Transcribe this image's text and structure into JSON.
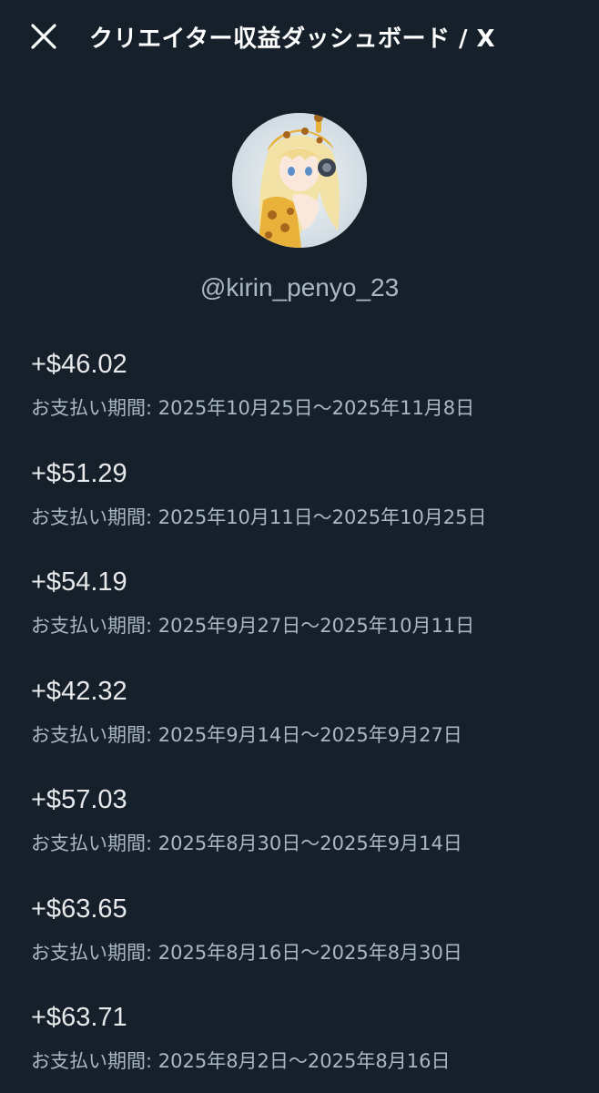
{
  "header": {
    "title": "クリエイター収益ダッシュボード / X"
  },
  "profile": {
    "handle": "@kirin_penyo_23"
  },
  "payouts": [
    {
      "amount": "+$46.02",
      "period": "お支払い期間: 2025年10月25日〜2025年11月8日"
    },
    {
      "amount": "+$51.29",
      "period": "お支払い期間: 2025年10月11日〜2025年10月25日"
    },
    {
      "amount": "+$54.19",
      "period": "お支払い期間: 2025年9月27日〜2025年10月11日"
    },
    {
      "amount": "+$42.32",
      "period": "お支払い期間: 2025年9月14日〜2025年9月27日"
    },
    {
      "amount": "+$57.03",
      "period": "お支払い期間: 2025年8月30日〜2025年9月14日"
    },
    {
      "amount": "+$63.65",
      "period": "お支払い期間: 2025年8月16日〜2025年8月30日"
    },
    {
      "amount": "+$63.71",
      "period": "お支払い期間: 2025年8月2日〜2025年8月16日"
    }
  ],
  "colors": {
    "background": "#15202b",
    "primary_text": "#e7e9ea",
    "secondary_text": "#aab8c2"
  },
  "icons": {
    "close": "close-icon",
    "avatar": "avatar-image"
  }
}
